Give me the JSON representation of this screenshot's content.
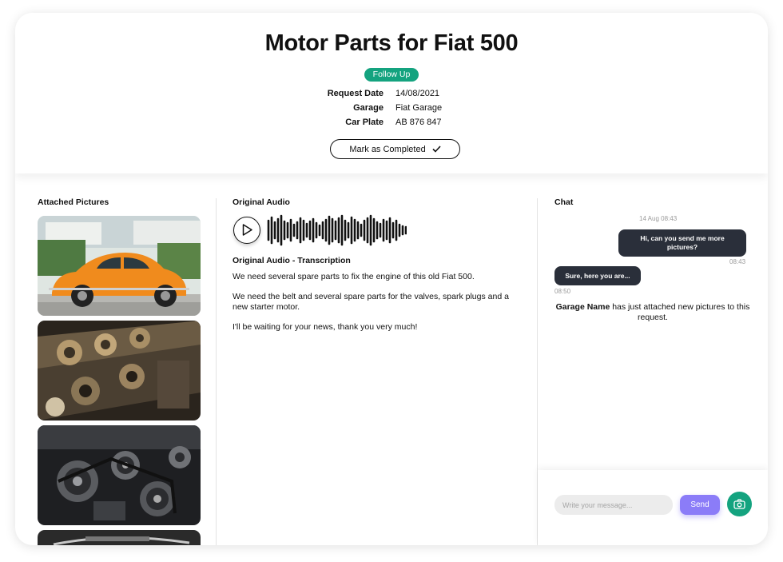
{
  "header": {
    "title": "Motor Parts for Fiat 500",
    "status_badge": "Follow Up",
    "details": [
      {
        "label": "Request Date",
        "value": "14/08/2021"
      },
      {
        "label": "Garage",
        "value": "Fiat Garage"
      },
      {
        "label": "Car Plate",
        "value": "AB 876 847"
      }
    ],
    "complete_button": "Mark as Completed"
  },
  "pictures": {
    "heading": "Attached Pictures",
    "items": [
      "orange-beetle-photo",
      "engine-photo",
      "engine-belts-photo",
      "partial-photo"
    ]
  },
  "audio": {
    "heading": "Original Audio",
    "transcription_heading": "Original Audio - Transcription",
    "paragraphs": [
      "We need several spare parts to fix the engine of this old Fiat 500.",
      "We need the belt and several spare parts for the valves, spark plugs and a new starter motor.",
      "I'll be waiting for your news, thank you very much!"
    ]
  },
  "chat": {
    "heading": "Chat",
    "date_stamp": "14 Aug 08:43",
    "messages": [
      {
        "text": "Hi, can you send me more pictures?",
        "time": "08:43",
        "side": "right"
      },
      {
        "text": "Sure, here you are...",
        "time": "08:50",
        "side": "left"
      }
    ],
    "system_message": {
      "name": "Garage Name",
      "text": " has just attached new pictures to this request."
    },
    "input_placeholder": "Write your message...",
    "send_label": "Send"
  },
  "colors": {
    "accent_green": "#14a37f",
    "send_purple": "#8b7cf8",
    "bubble_dark": "#2a2f3a"
  }
}
